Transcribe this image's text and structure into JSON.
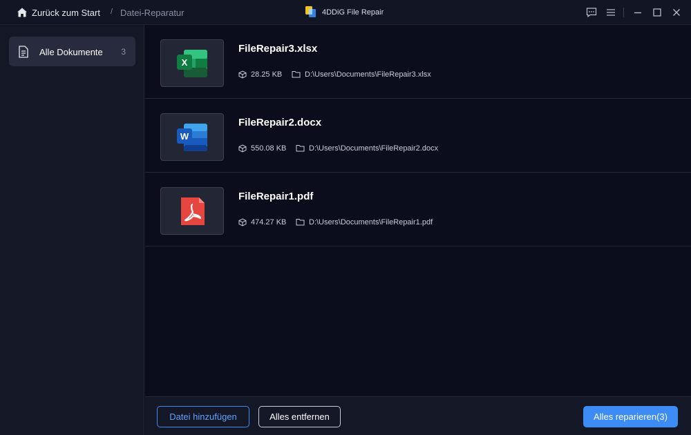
{
  "titlebar": {
    "home_label": "Zurück zum Start",
    "separator": "/",
    "breadcrumb": "Datei-Reparatur",
    "app_title": "4DDiG File Repair",
    "icons": [
      "home-icon",
      "app-logo-icon",
      "feedback-icon",
      "menu-icon",
      "minimize-icon",
      "maximize-icon",
      "close-icon"
    ]
  },
  "sidebar": {
    "items": [
      {
        "label": "Alle Dokumente",
        "count": "3",
        "icon": "document-icon"
      }
    ]
  },
  "files": [
    {
      "name": "FileRepair3.xlsx",
      "size": "28.25 KB",
      "path": "D:\\Users\\Documents\\FileRepair3.xlsx",
      "type": "excel",
      "badge": "X",
      "accent": "#21a366"
    },
    {
      "name": "FileRepair2.docx",
      "size": "550.08 KB",
      "path": "D:\\Users\\Documents\\FileRepair2.docx",
      "type": "word",
      "badge": "W",
      "accent": "#2b7cd3"
    },
    {
      "name": "FileRepair1.pdf",
      "size": "474.27 KB",
      "path": "D:\\Users\\Documents\\FileRepair1.pdf",
      "type": "pdf",
      "badge": "",
      "accent": "#e5463f"
    }
  ],
  "bottombar": {
    "add_label": "Datei hinzufügen",
    "remove_label": "Alles entfernen",
    "repair_label": "Alles reparieren(3)"
  },
  "colors": {
    "background": "#0b0d1c",
    "sidebar": "#141726",
    "accent": "#3d8cf5"
  }
}
